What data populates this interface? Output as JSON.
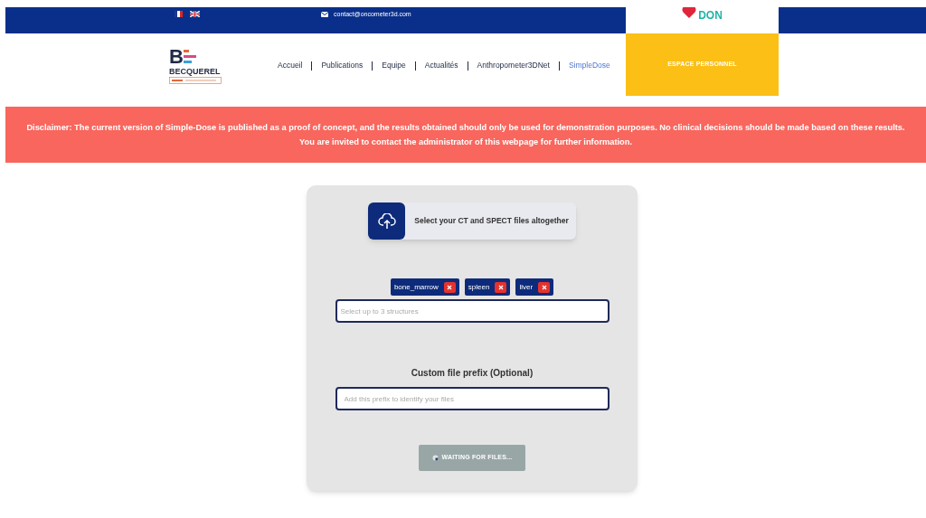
{
  "top_bar": {
    "languages": [
      {
        "kind": "fr",
        "selected": false
      },
      {
        "kind": "uk",
        "selected": false
      }
    ],
    "email": "contact@oncometer3d.com",
    "donate": {
      "big": "DON"
    }
  },
  "header": {
    "logo": {
      "mark": "B",
      "name": "BECQUEREL"
    },
    "nav": [
      {
        "label": "Accueil",
        "selected": false
      },
      {
        "label": "Publications",
        "selected": false
      },
      {
        "label": "Equipe",
        "selected": false
      },
      {
        "label": "Actualités",
        "selected": false
      },
      {
        "label": "Anthropometer3DNet",
        "selected": false
      },
      {
        "label": "SimpleDose",
        "selected": true
      }
    ],
    "account_button": "ESPACE PERSONNEL"
  },
  "disclaimer": "Disclaimer: The current version of Simple-Dose is published as a proof of concept, and the results obtained should only be used for demonstration purposes. No clinical decisions should be made based on these results. You are invited to contact the administrator of this webpage for further information.",
  "form": {
    "upload_label": "Select your CT and SPECT files altogether",
    "structures": {
      "tags": [
        "bone_marrow",
        "spleen",
        "liver"
      ],
      "placeholder": "Select up to 3 structures"
    },
    "prefix": {
      "label": "Custom file prefix (Optional)",
      "placeholder": "Add this prefix to identify your files"
    },
    "submit": {
      "label": "WAITING FOR FILES...",
      "disabled": true
    }
  }
}
